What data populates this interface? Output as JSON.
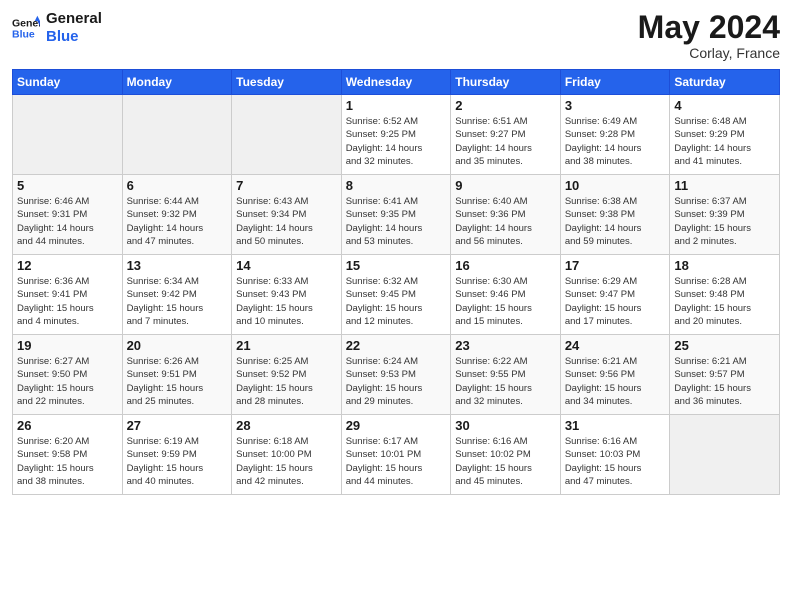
{
  "header": {
    "logo_line1": "General",
    "logo_line2": "Blue",
    "month_year": "May 2024",
    "location": "Corlay, France"
  },
  "days_of_week": [
    "Sunday",
    "Monday",
    "Tuesday",
    "Wednesday",
    "Thursday",
    "Friday",
    "Saturday"
  ],
  "weeks": [
    [
      {
        "num": "",
        "info": ""
      },
      {
        "num": "",
        "info": ""
      },
      {
        "num": "",
        "info": ""
      },
      {
        "num": "1",
        "info": "Sunrise: 6:52 AM\nSunset: 9:25 PM\nDaylight: 14 hours\nand 32 minutes."
      },
      {
        "num": "2",
        "info": "Sunrise: 6:51 AM\nSunset: 9:27 PM\nDaylight: 14 hours\nand 35 minutes."
      },
      {
        "num": "3",
        "info": "Sunrise: 6:49 AM\nSunset: 9:28 PM\nDaylight: 14 hours\nand 38 minutes."
      },
      {
        "num": "4",
        "info": "Sunrise: 6:48 AM\nSunset: 9:29 PM\nDaylight: 14 hours\nand 41 minutes."
      }
    ],
    [
      {
        "num": "5",
        "info": "Sunrise: 6:46 AM\nSunset: 9:31 PM\nDaylight: 14 hours\nand 44 minutes."
      },
      {
        "num": "6",
        "info": "Sunrise: 6:44 AM\nSunset: 9:32 PM\nDaylight: 14 hours\nand 47 minutes."
      },
      {
        "num": "7",
        "info": "Sunrise: 6:43 AM\nSunset: 9:34 PM\nDaylight: 14 hours\nand 50 minutes."
      },
      {
        "num": "8",
        "info": "Sunrise: 6:41 AM\nSunset: 9:35 PM\nDaylight: 14 hours\nand 53 minutes."
      },
      {
        "num": "9",
        "info": "Sunrise: 6:40 AM\nSunset: 9:36 PM\nDaylight: 14 hours\nand 56 minutes."
      },
      {
        "num": "10",
        "info": "Sunrise: 6:38 AM\nSunset: 9:38 PM\nDaylight: 14 hours\nand 59 minutes."
      },
      {
        "num": "11",
        "info": "Sunrise: 6:37 AM\nSunset: 9:39 PM\nDaylight: 15 hours\nand 2 minutes."
      }
    ],
    [
      {
        "num": "12",
        "info": "Sunrise: 6:36 AM\nSunset: 9:41 PM\nDaylight: 15 hours\nand 4 minutes."
      },
      {
        "num": "13",
        "info": "Sunrise: 6:34 AM\nSunset: 9:42 PM\nDaylight: 15 hours\nand 7 minutes."
      },
      {
        "num": "14",
        "info": "Sunrise: 6:33 AM\nSunset: 9:43 PM\nDaylight: 15 hours\nand 10 minutes."
      },
      {
        "num": "15",
        "info": "Sunrise: 6:32 AM\nSunset: 9:45 PM\nDaylight: 15 hours\nand 12 minutes."
      },
      {
        "num": "16",
        "info": "Sunrise: 6:30 AM\nSunset: 9:46 PM\nDaylight: 15 hours\nand 15 minutes."
      },
      {
        "num": "17",
        "info": "Sunrise: 6:29 AM\nSunset: 9:47 PM\nDaylight: 15 hours\nand 17 minutes."
      },
      {
        "num": "18",
        "info": "Sunrise: 6:28 AM\nSunset: 9:48 PM\nDaylight: 15 hours\nand 20 minutes."
      }
    ],
    [
      {
        "num": "19",
        "info": "Sunrise: 6:27 AM\nSunset: 9:50 PM\nDaylight: 15 hours\nand 22 minutes."
      },
      {
        "num": "20",
        "info": "Sunrise: 6:26 AM\nSunset: 9:51 PM\nDaylight: 15 hours\nand 25 minutes."
      },
      {
        "num": "21",
        "info": "Sunrise: 6:25 AM\nSunset: 9:52 PM\nDaylight: 15 hours\nand 28 minutes."
      },
      {
        "num": "22",
        "info": "Sunrise: 6:24 AM\nSunset: 9:53 PM\nDaylight: 15 hours\nand 29 minutes."
      },
      {
        "num": "23",
        "info": "Sunrise: 6:22 AM\nSunset: 9:55 PM\nDaylight: 15 hours\nand 32 minutes."
      },
      {
        "num": "24",
        "info": "Sunrise: 6:21 AM\nSunset: 9:56 PM\nDaylight: 15 hours\nand 34 minutes."
      },
      {
        "num": "25",
        "info": "Sunrise: 6:21 AM\nSunset: 9:57 PM\nDaylight: 15 hours\nand 36 minutes."
      }
    ],
    [
      {
        "num": "26",
        "info": "Sunrise: 6:20 AM\nSunset: 9:58 PM\nDaylight: 15 hours\nand 38 minutes."
      },
      {
        "num": "27",
        "info": "Sunrise: 6:19 AM\nSunset: 9:59 PM\nDaylight: 15 hours\nand 40 minutes."
      },
      {
        "num": "28",
        "info": "Sunrise: 6:18 AM\nSunset: 10:00 PM\nDaylight: 15 hours\nand 42 minutes."
      },
      {
        "num": "29",
        "info": "Sunrise: 6:17 AM\nSunset: 10:01 PM\nDaylight: 15 hours\nand 44 minutes."
      },
      {
        "num": "30",
        "info": "Sunrise: 6:16 AM\nSunset: 10:02 PM\nDaylight: 15 hours\nand 45 minutes."
      },
      {
        "num": "31",
        "info": "Sunrise: 6:16 AM\nSunset: 10:03 PM\nDaylight: 15 hours\nand 47 minutes."
      },
      {
        "num": "",
        "info": ""
      }
    ]
  ]
}
